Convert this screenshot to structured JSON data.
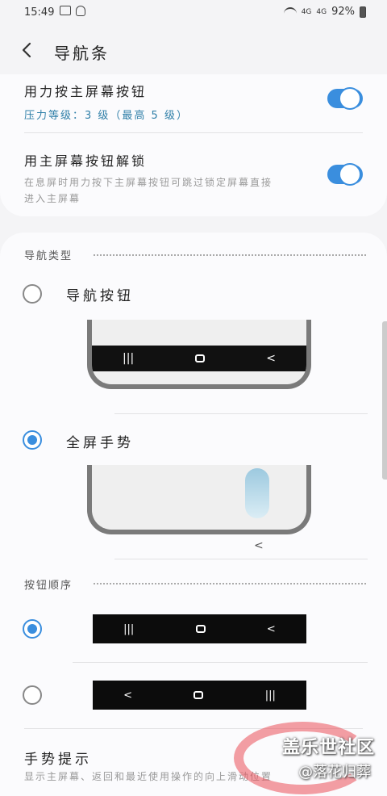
{
  "status_bar": {
    "time": "15:49",
    "battery": "92%",
    "network": "4G"
  },
  "header": {
    "title": "导航条"
  },
  "card1": {
    "pressure_row": {
      "title": "用力按主屏幕按钮",
      "sub": "压力等级：3 级（最高 5 级）",
      "toggle_on": true
    },
    "unlock_row": {
      "title": "用主屏幕按钮解锁",
      "desc_line1": "在息屏时用力按下主屏幕按钮可跳过锁定屏幕直接",
      "desc_line2": "进入主屏幕",
      "toggle_on": true
    }
  },
  "nav_type": {
    "section_label": "导航类型",
    "options": [
      {
        "label": "导航按钮",
        "selected": false,
        "nav_glyphs": [
          "|||",
          "O",
          "<"
        ]
      },
      {
        "label": "全屏手势",
        "selected": true,
        "hint_glyph": "<"
      }
    ]
  },
  "button_order": {
    "section_label": "按钮顺序",
    "options": [
      {
        "selected": true,
        "glyphs": [
          "|||",
          "O",
          "<"
        ]
      },
      {
        "selected": false,
        "glyphs": [
          "<",
          "O",
          "|||"
        ]
      }
    ]
  },
  "gesture_hint": {
    "title": "手势提示",
    "desc": "显示主屏幕、返回和最近使用操作的向上滑动位置"
  },
  "watermark": {
    "brand": "盖乐世社区",
    "user": "@落花归葬"
  },
  "colors": {
    "accent": "#3a8ede",
    "link": "#2f7fa8",
    "background": "#f4f4f6",
    "card": "#fbfbfd"
  },
  "icons": {
    "back": "back-arrow-icon",
    "image": "gallery-icon",
    "bell": "notification-icon",
    "wifi": "wifi-icon",
    "battery": "battery-icon"
  }
}
